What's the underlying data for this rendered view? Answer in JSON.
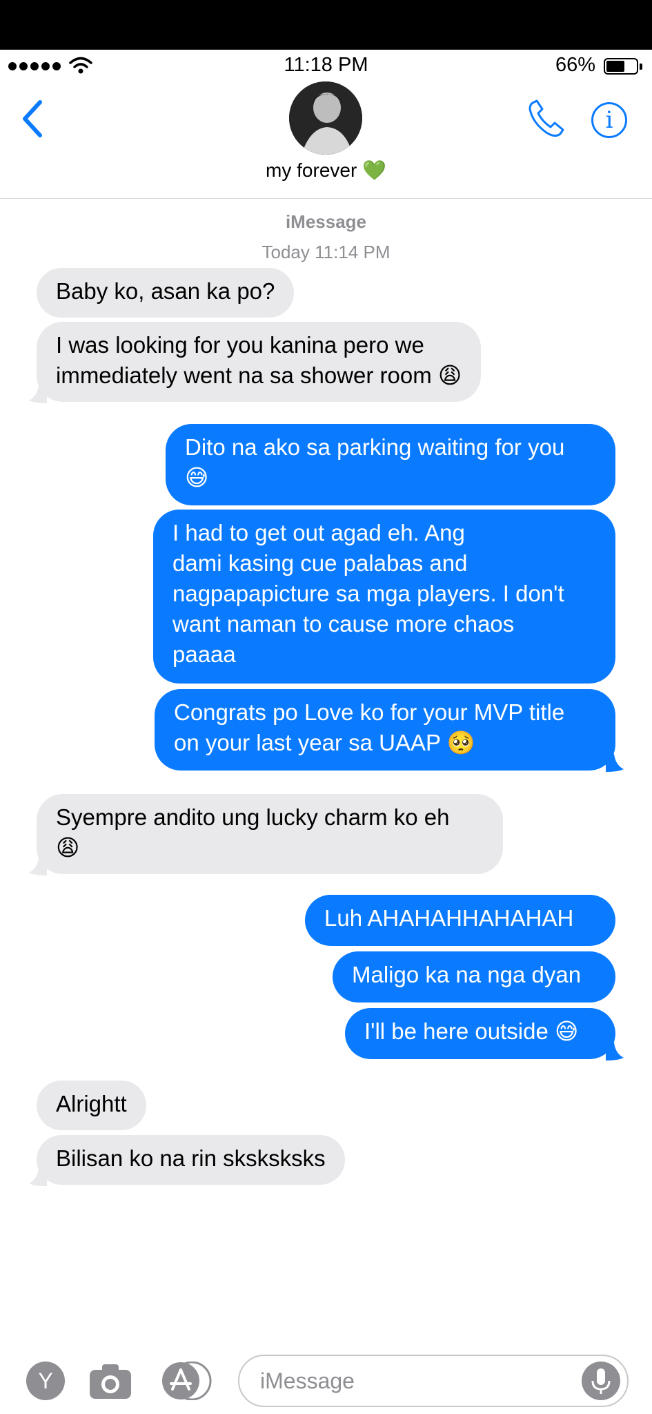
{
  "status_bar": {
    "time": "11:18 PM",
    "battery": "66%"
  },
  "header": {
    "contact_name": "my forever 💚"
  },
  "thread": {
    "service": "iMessage",
    "timestamp": "Today 11:14 PM"
  },
  "messages": [
    {
      "text": "Baby ko, asan ka po?"
    },
    {
      "line1": "I was looking for you kanina pero we",
      "line2": "immediately went na sa shower room 😩"
    },
    {
      "line1": "Dito na ako sa parking waiting for you",
      "line2": "😅"
    },
    {
      "line1": "I had to get out agad eh. Ang",
      "line2": "dami kasing cue palabas and",
      "line3": "nagpapapicture sa mga players. I don't",
      "line4": "want naman to cause more chaos",
      "line5": "paaaa"
    },
    {
      "line1": "Congrats po Love ko for your MVP title",
      "line2": "on your last year sa UAAP 🥺"
    },
    {
      "line1": "Syempre andito ung lucky charm ko eh",
      "line2": "😩"
    },
    {
      "text": "Luh AHAHAHHAHAHAH"
    },
    {
      "text": "Maligo ka na nga dyan"
    },
    {
      "text": "I'll be here outside 😅"
    },
    {
      "text": "Alrightt"
    },
    {
      "text": "Bilisan ko na rin sksksksks"
    }
  ],
  "composer": {
    "placeholder": "iMessage",
    "app_label": "Y"
  },
  "colors": {
    "outgoing": "#0a7bff",
    "incoming": "#e9e9eb",
    "accent": "#0a7bff"
  }
}
